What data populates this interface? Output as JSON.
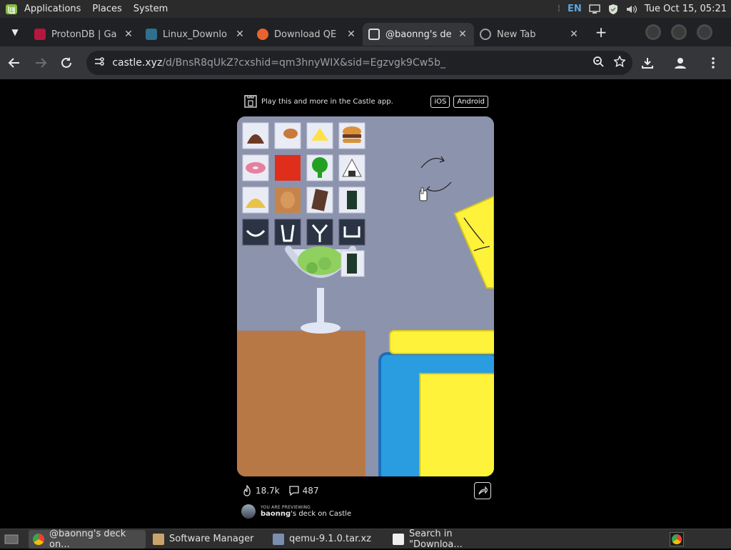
{
  "os_panel": {
    "menus": [
      "Applications",
      "Places",
      "System"
    ],
    "lang": "EN",
    "clock": "Tue Oct 15, 05:21"
  },
  "browser": {
    "tabs": [
      {
        "title": "ProtonDB | Ga",
        "icon": "protondb-icon",
        "color": "#b5173d"
      },
      {
        "title": "Linux_Downlo",
        "icon": "linux-download-icon",
        "color": "#2f6f8f"
      },
      {
        "title": "Download QE",
        "icon": "qemu-icon",
        "color": "#e8642c"
      },
      {
        "title": "@baonng's de",
        "icon": "castle-icon",
        "color": "#ffffff",
        "active": true
      },
      {
        "title": "New Tab",
        "icon": "globe-icon",
        "color": "#9aa0a6"
      }
    ],
    "url_host": "castle.xyz",
    "url_rest": "/d/BnsR8qUkZ?cxshid=qm3hnyWIX&sid=Egzvgk9Cw5b_"
  },
  "page": {
    "promo_text": "Play this and more in the Castle app.",
    "ios_label": "iOS",
    "android_label": "Android",
    "likes": "18.7k",
    "comments": "487",
    "previewing_label": "YOU ARE PREVIEWING",
    "deck_owner": "baonng",
    "deck_suffix": "'s deck on Castle"
  },
  "game": {
    "items": [
      "poop",
      "chicken-leg",
      "cheese",
      "burger",
      "donut",
      "red-card",
      "broccoli",
      "onigiri",
      "taco",
      "face-card",
      "chocolate",
      "creeper",
      "bowl-cup",
      "tall-cup",
      "martini-cup",
      "short-cup"
    ],
    "colors": {
      "background": "#8c93ad",
      "table": "#b87846",
      "blue_box": "#2a9de0",
      "yellow": "#fff23a"
    }
  },
  "taskbar": {
    "items": [
      {
        "label": "@baonng's deck on...",
        "icon": "chrome-icon",
        "active": true
      },
      {
        "label": "Software Manager",
        "icon": "software-manager-icon"
      },
      {
        "label": "qemu-9.1.0.tar.xz",
        "icon": "archive-icon"
      },
      {
        "label": "Search in \"Downloa...",
        "icon": "search-document-icon"
      }
    ]
  }
}
